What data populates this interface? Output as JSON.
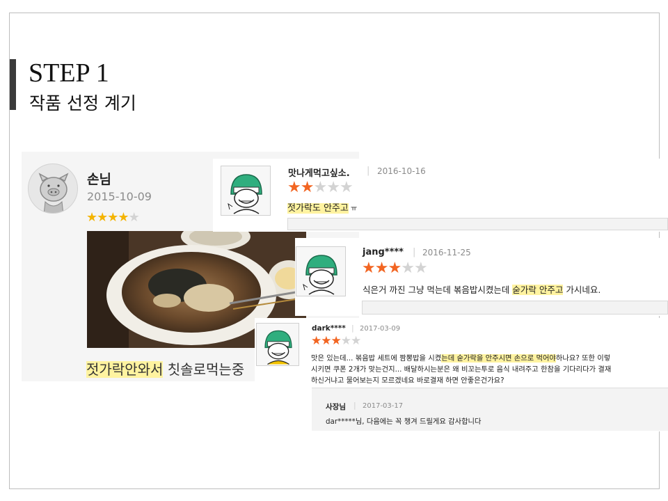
{
  "header": {
    "step_title": "STEP 1",
    "step_subtitle": "작품 선정 계기"
  },
  "colors": {
    "highlight": "#fff3a0",
    "star_orange": "#f26522",
    "star_yellow": "#f4b400",
    "star_empty": "#d3d3d3"
  },
  "review_main": {
    "avatar_icon": "pig-avatar-icon",
    "name": "손님",
    "date": "2015-10-09",
    "rating": 4,
    "max_rating": 5,
    "photo_icon": "food-bowl-photo",
    "caption_highlight": "젓가락안와서",
    "caption_rest": " 칫솔로먹는중"
  },
  "review_2": {
    "avatar_icon": "green-helmet-avatar-icon",
    "name": "맛나게먹고싶소.",
    "separator": "|",
    "date": "2016-10-16",
    "rating": 2,
    "max_rating": 5,
    "text_highlight": "젓가락도 안주고",
    "text_rest": " ㅠ"
  },
  "review_3": {
    "avatar_icon": "green-helmet-avatar-icon",
    "name": "jang****",
    "separator": "|",
    "date": "2016-11-25",
    "rating": 3,
    "max_rating": 5,
    "text_before": "식은거 까진 그냥 먹는데 볶음밥시켰는데 ",
    "text_highlight": "숟가락 안주고",
    "text_after": " 가시네요."
  },
  "review_4": {
    "avatar_icon": "green-helmet-avatar-icon",
    "name": "dark****",
    "separator": "|",
    "date": "2017-03-09",
    "rating": 3,
    "max_rating": 5,
    "line1_before": "맛은 있는데...  볶음밥 세트에 짬뽕밥을 시켰",
    "line1_highlight": "는데 숟가락을 안주시면 손으로 먹어야",
    "line1_after": "하나요? 또한 이렇",
    "line2": "시키면 쿠폰 2개가 맞는건지... 배달하시는분은 왜 비꼬는투로 음식 내려주고 한참을 기다리다가 결재",
    "line3": "하신거냐고 물어보는지 모르겠네요 바로결재 하면 안좋은건가요?",
    "reply": {
      "name": "사장님",
      "separator": "|",
      "date": "2017-03-17",
      "text": "dar*****님, 다음에는 꼭 챙겨 드릴게요 감사합니다"
    }
  }
}
